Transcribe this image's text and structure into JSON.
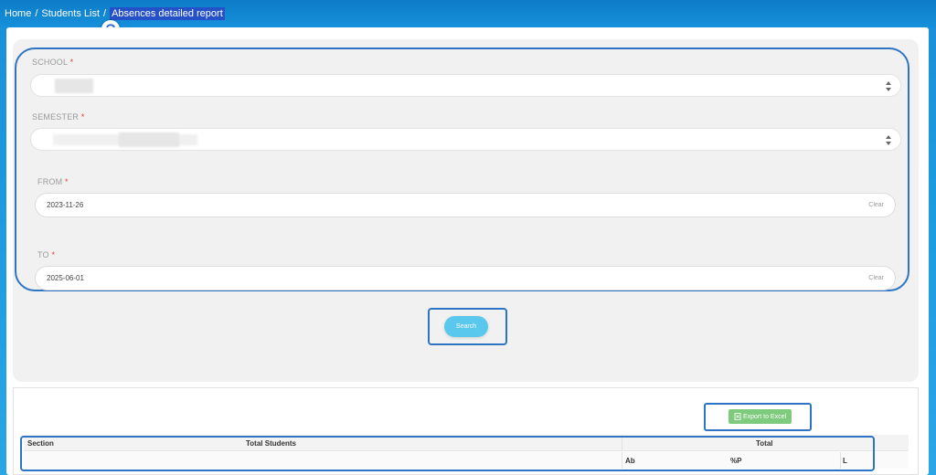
{
  "breadcrumb": {
    "items": [
      "Home",
      "Students List",
      "Absences detailed report"
    ],
    "separator": "/"
  },
  "form": {
    "school": {
      "label": "SCHOOL",
      "required_mark": "*"
    },
    "semester": {
      "label": "SEMESTER",
      "required_mark": "*"
    },
    "from": {
      "label": "FROM",
      "required_mark": "*",
      "value": "2023-11-26",
      "clear_label": "Clear"
    },
    "to": {
      "label": "TO",
      "required_mark": "*",
      "value": "2025-06-01",
      "clear_label": "Clear"
    },
    "search_label": "Search"
  },
  "results": {
    "export_label": "Export to Excel",
    "table": {
      "headers": [
        "Section",
        "Total Students",
        "Total"
      ],
      "subheaders": [
        "Ab",
        "%P",
        "L"
      ]
    }
  },
  "colors": {
    "highlight_border": "#2d75c4",
    "search_button": "#5ac8ec",
    "export_button": "#7ecb7e",
    "required": "#e03b3b"
  },
  "icons": {
    "refresh": "refresh-icon",
    "excel": "file-excel-icon",
    "select_arrows": "sort-arrows-icon"
  }
}
